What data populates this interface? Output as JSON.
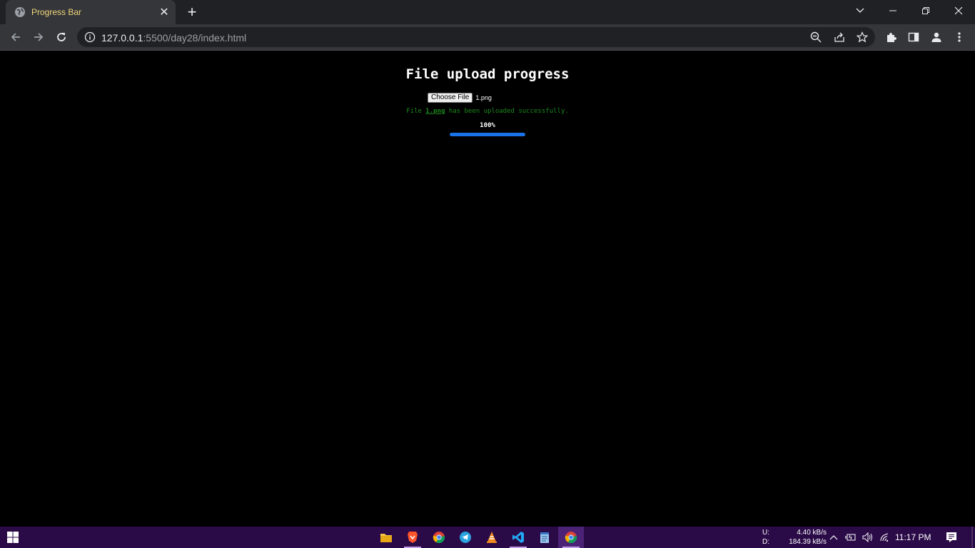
{
  "browser": {
    "tab_title": "Progress Bar",
    "url_host": "127.0.0.1",
    "url_rest": ":5500/day28/index.html"
  },
  "page": {
    "heading": "File upload progress",
    "file_input": {
      "button_label": "Choose File",
      "selected_file": "1.png"
    },
    "status": {
      "prefix": "File",
      "filename": "1.png",
      "suffix": "has been uploaded successfully."
    },
    "progress": {
      "label": "100%",
      "value": 1.0
    }
  },
  "taskbar": {
    "apps": [
      "file-explorer-icon",
      "brave-icon",
      "chrome-icon",
      "telegram-icon",
      "vlc-icon",
      "vscode-icon",
      "notepad-icon",
      "chrome-canary-icon"
    ],
    "network": {
      "upload_label": "U:",
      "upload_speed": "4.40 kB/s",
      "download_label": "D:",
      "download_speed": "184.39 kB/s"
    },
    "clock": "11:17 PM"
  },
  "colors": {
    "accent": "#1a73e8",
    "status_text": "#1e8a1e",
    "taskbar": "#2a0a47",
    "tab_title": "#f1d77a"
  }
}
